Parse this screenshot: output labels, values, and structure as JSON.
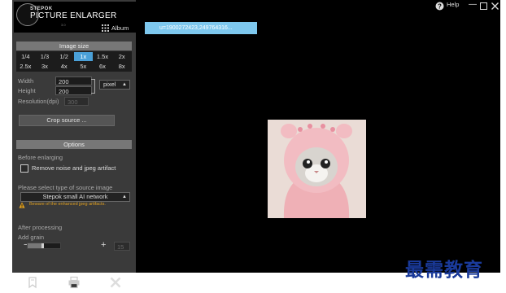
{
  "app": {
    "brand_top": "STEPOK",
    "brand_main": "PICTURE ENLARGER",
    "brand_sub": "3.0"
  },
  "toolbar": {
    "album_label": "Album",
    "url_text": "u=1900272423,249764316...",
    "help_label": "Help"
  },
  "image_size": {
    "header": "Image size",
    "scales": [
      "1/4",
      "1/3",
      "1/2",
      "1x",
      "1.5x",
      "2x",
      "2.5x",
      "3x",
      "4x",
      "5x",
      "6x",
      "8x"
    ],
    "selected_scale": "1x",
    "width_label": "Width",
    "width_value": "200",
    "height_label": "Height",
    "height_value": "200",
    "unit": "pixel",
    "resolution_label": "Resolution(dpi)",
    "resolution_value": "300",
    "crop_button": "Crop source ..."
  },
  "options": {
    "header": "Options",
    "before_label": "Before enlarging",
    "noise_label": "Remove noise and jpeg artifact",
    "noise_checked": false,
    "source_type_label": "Please select type of source image",
    "source_type_value": "Stepok small AI network",
    "warning": "Beware of the enhanced jpeg artifacts.",
    "after_label": "After processing",
    "grain_label": "Add grain",
    "grain_minus": "−",
    "grain_plus": "+",
    "grain_value": "15",
    "grain_fraction": 0.4
  },
  "icons": {
    "save": "save-icon",
    "print": "print-icon",
    "close": "close-icon",
    "help": "help-icon",
    "album": "grid-icon"
  },
  "colors": {
    "accent": "#4aa0d8",
    "url_bar": "#7ec8ee",
    "panel": "#3a3a3a",
    "section_header": "#777777",
    "warning": "#e0a020",
    "watermark": "#1a3a9a"
  },
  "watermark": "最需教育"
}
